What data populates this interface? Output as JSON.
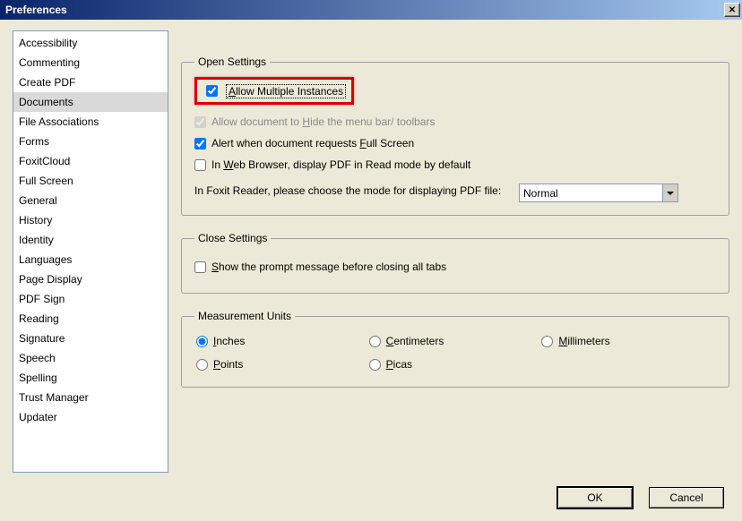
{
  "window": {
    "title": "Preferences"
  },
  "sidebar": {
    "items": [
      {
        "label": "Accessibility",
        "selected": false
      },
      {
        "label": "Commenting",
        "selected": false
      },
      {
        "label": "Create PDF",
        "selected": false
      },
      {
        "label": "Documents",
        "selected": true
      },
      {
        "label": "File Associations",
        "selected": false
      },
      {
        "label": "Forms",
        "selected": false
      },
      {
        "label": "FoxitCloud",
        "selected": false
      },
      {
        "label": "Full Screen",
        "selected": false
      },
      {
        "label": "General",
        "selected": false
      },
      {
        "label": "History",
        "selected": false
      },
      {
        "label": "Identity",
        "selected": false
      },
      {
        "label": "Languages",
        "selected": false
      },
      {
        "label": "Page Display",
        "selected": false
      },
      {
        "label": "PDF Sign",
        "selected": false
      },
      {
        "label": "Reading",
        "selected": false
      },
      {
        "label": "Signature",
        "selected": false
      },
      {
        "label": "Speech",
        "selected": false
      },
      {
        "label": "Spelling",
        "selected": false
      },
      {
        "label": "Trust Manager",
        "selected": false
      },
      {
        "label": "Updater",
        "selected": false
      }
    ]
  },
  "open_settings": {
    "legend": "Open Settings",
    "allow_multiple_instances": {
      "label": "Allow Multiple Instances",
      "checked": true,
      "highlighted": true
    },
    "allow_hide_menu": {
      "label": "Allow document to Hide the menu bar/ toolbars",
      "checked": true,
      "disabled": true
    },
    "alert_full_screen": {
      "label": "Alert when document requests Full Screen",
      "checked": true
    },
    "web_browser_read_mode": {
      "label": "In Web Browser, display PDF in Read mode by default",
      "checked": false
    },
    "mode_label": "In Foxit Reader, please choose the mode for displaying PDF file:",
    "mode_value": "Normal"
  },
  "close_settings": {
    "legend": "Close Settings",
    "show_prompt": {
      "label": "Show the prompt message before closing all tabs",
      "checked": false
    }
  },
  "measurement_units": {
    "legend": "Measurement Units",
    "options": [
      {
        "label": "Inches",
        "selected": true
      },
      {
        "label": "Centimeters",
        "selected": false
      },
      {
        "label": "Millimeters",
        "selected": false
      },
      {
        "label": "Points",
        "selected": false
      },
      {
        "label": "Picas",
        "selected": false
      }
    ]
  },
  "buttons": {
    "ok": "OK",
    "cancel": "Cancel"
  }
}
